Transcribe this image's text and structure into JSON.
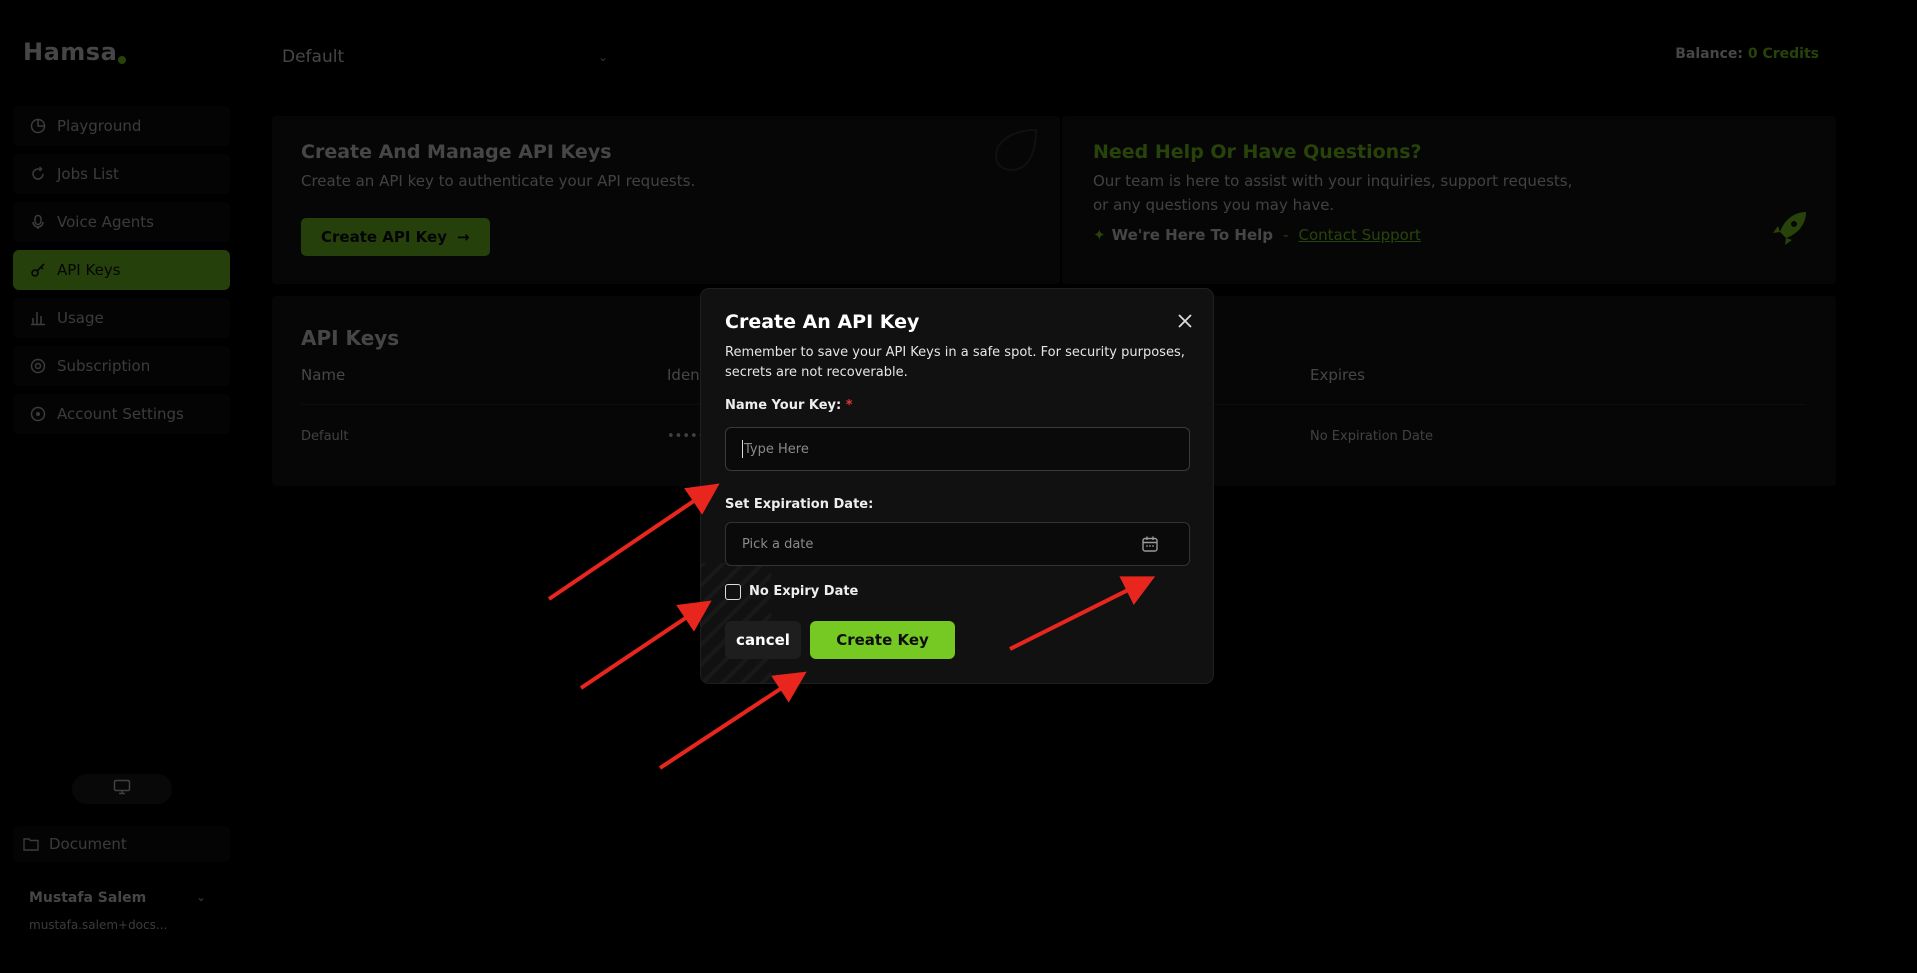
{
  "brand": {
    "name": "Hamsa",
    "accent": "#76c922"
  },
  "sidebar": {
    "items": [
      {
        "label": "Playground",
        "icon": "chart-pie-icon",
        "active": false
      },
      {
        "label": "Jobs List",
        "icon": "refresh-icon",
        "active": false
      },
      {
        "label": "Voice Agents",
        "icon": "microphone-icon",
        "active": false
      },
      {
        "label": "API Keys",
        "icon": "key-icon",
        "active": true
      },
      {
        "label": "Usage",
        "icon": "bar-chart-icon",
        "active": false
      },
      {
        "label": "Subscription",
        "icon": "subscription-icon",
        "active": false
      },
      {
        "label": "Account Settings",
        "icon": "gear-icon",
        "active": false
      }
    ],
    "document_label": "Document",
    "user": {
      "name": "Mustafa Salem",
      "email": "mustafa.salem+docs..."
    }
  },
  "header": {
    "project": "Default",
    "balance_label": "Balance:",
    "balance_value": "0 Credits"
  },
  "cards": {
    "left": {
      "title": "Create And Manage API Keys",
      "subtitle": "Create an API key to authenticate your API requests.",
      "button": "Create API Key"
    },
    "right": {
      "title": "Need Help Or Have Questions?",
      "line1": "Our team is here to assist with your inquiries, support requests,",
      "line2": "or any questions you may have.",
      "help_text": "We're Here To Help",
      "separator": "-",
      "link": "Contact Support"
    }
  },
  "table": {
    "title": "API Keys",
    "headers": {
      "name": "Name",
      "identifier": "Ident",
      "expires": "Expires"
    },
    "rows": [
      {
        "name": "Default",
        "identifier": "••••••••••",
        "expires": "No Expiration Date"
      }
    ]
  },
  "modal": {
    "title": "Create An API Key",
    "description": "Remember to save your API Keys in a safe spot. For security purposes, secrets are not recoverable.",
    "name_label": "Name Your Key:",
    "required_mark": "*",
    "name_placeholder": "Type Here",
    "date_label": "Set Expiration Date:",
    "date_placeholder": "Pick a date",
    "no_expiry_label": "No Expiry Date",
    "cancel_label": "cancel",
    "create_label": "Create Key"
  }
}
